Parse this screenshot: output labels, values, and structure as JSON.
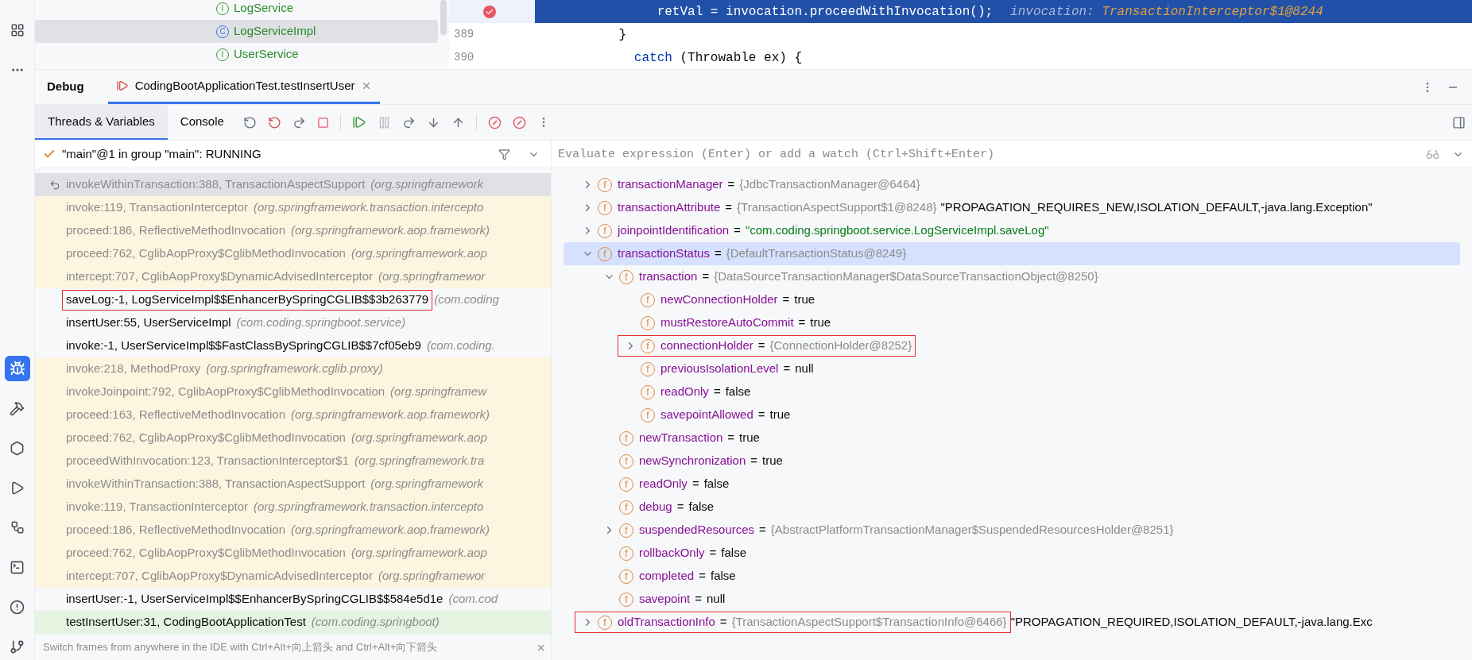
{
  "project_tree": {
    "items": [
      {
        "kind": "interface",
        "icon": "I",
        "label": "LogService",
        "selected": false
      },
      {
        "kind": "class",
        "icon": "C",
        "label": "LogServiceImpl",
        "selected": true
      },
      {
        "kind": "interface",
        "icon": "I",
        "label": "UserService",
        "selected": false
      }
    ]
  },
  "editor": {
    "lines": [
      {
        "breakpoint": true,
        "current": true,
        "tokens": [
          {
            "kind": "plain",
            "text": "                retVal = invocation.proceedWithInvocation();"
          }
        ],
        "hint_label": "invocation:",
        "hint_value": "TransactionInterceptor$1@8244"
      },
      {
        "number": "389",
        "breakpoint": false,
        "current": false,
        "tokens": [
          {
            "kind": "plain",
            "text": "           }"
          }
        ]
      },
      {
        "number": "390",
        "breakpoint": false,
        "current": false,
        "tokens": [
          {
            "kind": "keyword",
            "text": "             catch"
          },
          {
            "kind": "plain",
            "text": " (Throwable ex) {"
          }
        ]
      }
    ]
  },
  "debug": {
    "title": "Debug",
    "session_tab": {
      "label": "CodingBootApplicationTest.testInsertUser",
      "selected": true
    }
  },
  "tabs": [
    {
      "label": "Threads & Variables",
      "selected": true
    },
    {
      "label": "Console",
      "selected": false
    }
  ],
  "thread": {
    "label": "\"main\"@1 in group \"main\": RUNNING"
  },
  "evaluate": {
    "placeholder": "Evaluate expression (Enter) or add a watch (Ctrl+Shift+Enter)"
  },
  "frames": [
    {
      "method": "invokeWithinTransaction:388, TransactionAspectSupport",
      "package": "(org.springframework",
      "kind": "library",
      "selected": true,
      "highlighted": false
    },
    {
      "method": "invoke:119, TransactionInterceptor",
      "package": "(org.springframework.transaction.intercepto",
      "kind": "library",
      "selected": false,
      "highlighted": false
    },
    {
      "method": "proceed:186, ReflectiveMethodInvocation",
      "package": "(org.springframework.aop.framework)",
      "kind": "library",
      "selected": false,
      "highlighted": false
    },
    {
      "method": "proceed:762, CglibAopProxy$CglibMethodInvocation",
      "package": "(org.springframework.aop",
      "kind": "library",
      "selected": false,
      "highlighted": false
    },
    {
      "method": "intercept:707, CglibAopProxy$DynamicAdvisedInterceptor",
      "package": "(org.springframewor",
      "kind": "library",
      "selected": false,
      "highlighted": false
    },
    {
      "method": "saveLog:-1, LogServiceImpl$$EnhancerBySpringCGLIB$$3b263779",
      "package": "(com.coding",
      "kind": "user",
      "selected": false,
      "highlighted": true
    },
    {
      "method": "insertUser:55, UserServiceImpl",
      "package": "(com.coding.springboot.service)",
      "kind": "user",
      "selected": false,
      "highlighted": false
    },
    {
      "method": "invoke:-1, UserServiceImpl$$FastClassBySpringCGLIB$$7cf05eb9",
      "package": "(com.coding.",
      "kind": "user",
      "selected": false,
      "highlighted": false
    },
    {
      "method": "invoke:218, MethodProxy",
      "package": "(org.springframework.cglib.proxy)",
      "kind": "library",
      "selected": false,
      "highlighted": false
    },
    {
      "method": "invokeJoinpoint:792, CglibAopProxy$CglibMethodInvocation",
      "package": "(org.springframew",
      "kind": "library",
      "selected": false,
      "highlighted": false
    },
    {
      "method": "proceed:163, ReflectiveMethodInvocation",
      "package": "(org.springframework.aop.framework)",
      "kind": "library",
      "selected": false,
      "highlighted": false
    },
    {
      "method": "proceed:762, CglibAopProxy$CglibMethodInvocation",
      "package": "(org.springframework.aop",
      "kind": "library",
      "selected": false,
      "highlighted": false
    },
    {
      "method": "proceedWithInvocation:123, TransactionInterceptor$1",
      "package": "(org.springframework.tra",
      "kind": "library",
      "selected": false,
      "highlighted": false
    },
    {
      "method": "invokeWithinTransaction:388, TransactionAspectSupport",
      "package": "(org.springframework",
      "kind": "library",
      "selected": false,
      "highlighted": false
    },
    {
      "method": "invoke:119, TransactionInterceptor",
      "package": "(org.springframework.transaction.intercepto",
      "kind": "library",
      "selected": false,
      "highlighted": false
    },
    {
      "method": "proceed:186, ReflectiveMethodInvocation",
      "package": "(org.springframework.aop.framework)",
      "kind": "library",
      "selected": false,
      "highlighted": false
    },
    {
      "method": "proceed:762, CglibAopProxy$CglibMethodInvocation",
      "package": "(org.springframework.aop",
      "kind": "library",
      "selected": false,
      "highlighted": false
    },
    {
      "method": "intercept:707, CglibAopProxy$DynamicAdvisedInterceptor",
      "package": "(org.springframewor",
      "kind": "library",
      "selected": false,
      "highlighted": false
    },
    {
      "method": "insertUser:-1, UserServiceImpl$$EnhancerBySpringCGLIB$$584e5d1e",
      "package": "(com.cod",
      "kind": "user",
      "selected": false,
      "highlighted": false
    },
    {
      "method": "testInsertUser:31, CodingBootApplicationTest",
      "package": "(com.coding.springboot)",
      "kind": "entry",
      "selected": false,
      "highlighted": false
    }
  ],
  "frames_hint": "Switch frames from anywhere in the IDE with Ctrl+Alt+向上箭头 and Ctrl+Alt+向下箭头",
  "variables": [
    {
      "icon": "f",
      "name": "transactionManager",
      "sign": "=",
      "value": "{JdbcTransactionManager@6464}",
      "kind": "object",
      "expanded": false,
      "selected": false,
      "highlighted": false
    },
    {
      "icon": "f",
      "name": "transactionAttribute",
      "sign": "=",
      "value": "{TransactionAspectSupport$1@8248}",
      "kind": "object",
      "extra": "\"PROPAGATION_REQUIRES_NEW,ISOLATION_DEFAULT,-java.lang.Exception\"",
      "expanded": false,
      "selected": false,
      "highlighted": false
    },
    {
      "icon": "f",
      "name": "joinpointIdentification",
      "sign": "=",
      "value": "\"com.coding.springboot.service.LogServiceImpl.saveLog\"",
      "kind": "string",
      "expanded": false,
      "selected": false,
      "highlighted": false
    },
    {
      "icon": "f",
      "name": "transactionStatus",
      "sign": "=",
      "value": "{DefaultTransactionStatus@8249}",
      "kind": "object",
      "expanded": true,
      "selected": true,
      "highlighted": false,
      "children": [
        {
          "icon": "f",
          "name": "transaction",
          "sign": "=",
          "value": "{DataSourceTransactionManager$DataSourceTransactionObject@8250}",
          "kind": "object",
          "expanded": true,
          "selected": false,
          "highlighted": false,
          "children": [
            {
              "icon": "f",
              "name": "newConnectionHolder",
              "sign": "=",
              "value": "true",
              "kind": "primitive",
              "selected": false,
              "highlighted": false
            },
            {
              "icon": "f",
              "name": "mustRestoreAutoCommit",
              "sign": "=",
              "value": "true",
              "kind": "primitive",
              "selected": false,
              "highlighted": false
            },
            {
              "icon": "f",
              "name": "connectionHolder",
              "sign": "=",
              "value": "{ConnectionHolder@8252}",
              "kind": "object",
              "expanded": false,
              "selected": false,
              "highlighted": true
            },
            {
              "icon": "f",
              "name": "previousIsolationLevel",
              "sign": "=",
              "value": "null",
              "kind": "primitive",
              "selected": false,
              "highlighted": false
            },
            {
              "icon": "f",
              "name": "readOnly",
              "sign": "=",
              "value": "false",
              "kind": "primitive",
              "selected": false,
              "highlighted": false
            },
            {
              "icon": "f",
              "name": "savepointAllowed",
              "sign": "=",
              "value": "true",
              "kind": "primitive",
              "selected": false,
              "highlighted": false
            }
          ]
        },
        {
          "icon": "f",
          "name": "newTransaction",
          "sign": "=",
          "value": "true",
          "kind": "primitive",
          "selected": false,
          "highlighted": false
        },
        {
          "icon": "f",
          "name": "newSynchronization",
          "sign": "=",
          "value": "true",
          "kind": "primitive",
          "selected": false,
          "highlighted": false
        },
        {
          "icon": "f",
          "name": "readOnly",
          "sign": "=",
          "value": "false",
          "kind": "primitive",
          "selected": false,
          "highlighted": false
        },
        {
          "icon": "f",
          "name": "debug",
          "sign": "=",
          "value": "false",
          "kind": "primitive",
          "selected": false,
          "highlighted": false
        },
        {
          "icon": "f",
          "name": "suspendedResources",
          "sign": "=",
          "value": "{AbstractPlatformTransactionManager$SuspendedResourcesHolder@8251}",
          "kind": "object",
          "expanded": false,
          "selected": false,
          "highlighted": false
        },
        {
          "icon": "f",
          "name": "rollbackOnly",
          "sign": "=",
          "value": "false",
          "kind": "primitive",
          "selected": false,
          "highlighted": false
        },
        {
          "icon": "f",
          "name": "completed",
          "sign": "=",
          "value": "false",
          "kind": "primitive",
          "selected": false,
          "highlighted": false
        },
        {
          "icon": "f",
          "name": "savepoint",
          "sign": "=",
          "value": "null",
          "kind": "primitive",
          "selected": false,
          "highlighted": false
        }
      ]
    },
    {
      "icon": "f",
      "name": "oldTransactionInfo",
      "sign": "=",
      "value": "{TransactionAspectSupport$TransactionInfo@6466}",
      "kind": "object",
      "extra": "\"PROPAGATION_REQUIRED,ISOLATION_DEFAULT,-java.lang.Exc",
      "expanded": false,
      "selected": false,
      "highlighted": true
    }
  ]
}
